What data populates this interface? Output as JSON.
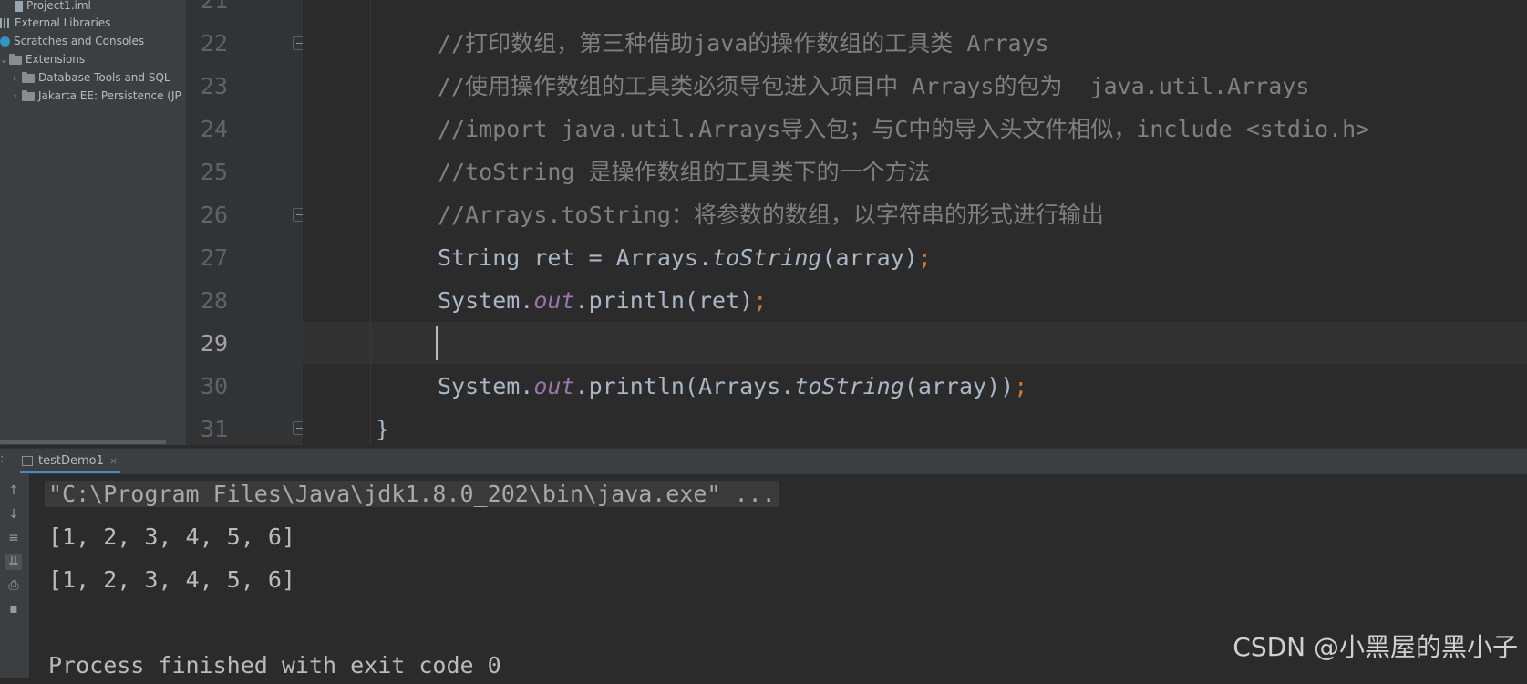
{
  "project_tree": {
    "items": [
      {
        "label": "Project1.iml",
        "icon": "file-icon"
      },
      {
        "label": "External Libraries",
        "icon": "library-icon"
      },
      {
        "label": "Scratches and Consoles",
        "icon": "scratches-icon"
      },
      {
        "label": "Extensions",
        "icon": "folder-icon"
      },
      {
        "label": "Database Tools and SQL",
        "icon": "folder-icon"
      },
      {
        "label": "Jakarta EE: Persistence (JP",
        "icon": "folder-icon"
      }
    ]
  },
  "editor": {
    "line_numbers": [
      "21",
      "22",
      "23",
      "24",
      "25",
      "26",
      "27",
      "28",
      "29",
      "30",
      "31"
    ],
    "current_line": "29",
    "lines": {
      "l22": "//打印数组，第三种借助java的操作数组的工具类 Arrays",
      "l23": "//使用操作数组的工具类必须导包进入项目中 Arrays的包为  java.util.Arrays",
      "l24": "//import java.util.Arrays导入包；与C中的导入头文件相似，include <stdio.h>",
      "l25": "//toString 是操作数组的工具类下的一个方法",
      "l26": "//Arrays.toString：将参数的数组，以字符串的形式进行输出",
      "l27": {
        "a": "String ret = Arrays.",
        "b": "toString",
        "c": "(array)",
        "d": ";"
      },
      "l28": {
        "a": "System.",
        "b": "out",
        "c": ".println(ret)",
        "d": ";"
      },
      "l30": {
        "a": "System.",
        "b": "out",
        "c": ".println(Arrays.",
        "d": "toString",
        "e": "(array))",
        "f": ";"
      },
      "l31": "}"
    }
  },
  "run_panel": {
    "tab_label": "testDemo1",
    "tab_close": "×",
    "toolbar_icons": [
      "up-arrow-icon",
      "down-arrow-icon",
      "soft-wrap-icon",
      "scroll-to-end-icon",
      "print-icon",
      "trash-icon"
    ],
    "console": {
      "command": "\"C:\\Program Files\\Java\\jdk1.8.0_202\\bin\\java.exe\" ...",
      "output1": "[1, 2, 3, 4, 5, 6]",
      "output2": "[1, 2, 3, 4, 5, 6]",
      "finished": "Process finished with exit code 0"
    }
  },
  "watermark": "CSDN @小黑屋的黑小子",
  "colors": {
    "background": "#2b2b2b",
    "comment": "#808080",
    "semicolon": "#cc7832",
    "field": "#9876aa",
    "text": "#a9b7c6"
  }
}
